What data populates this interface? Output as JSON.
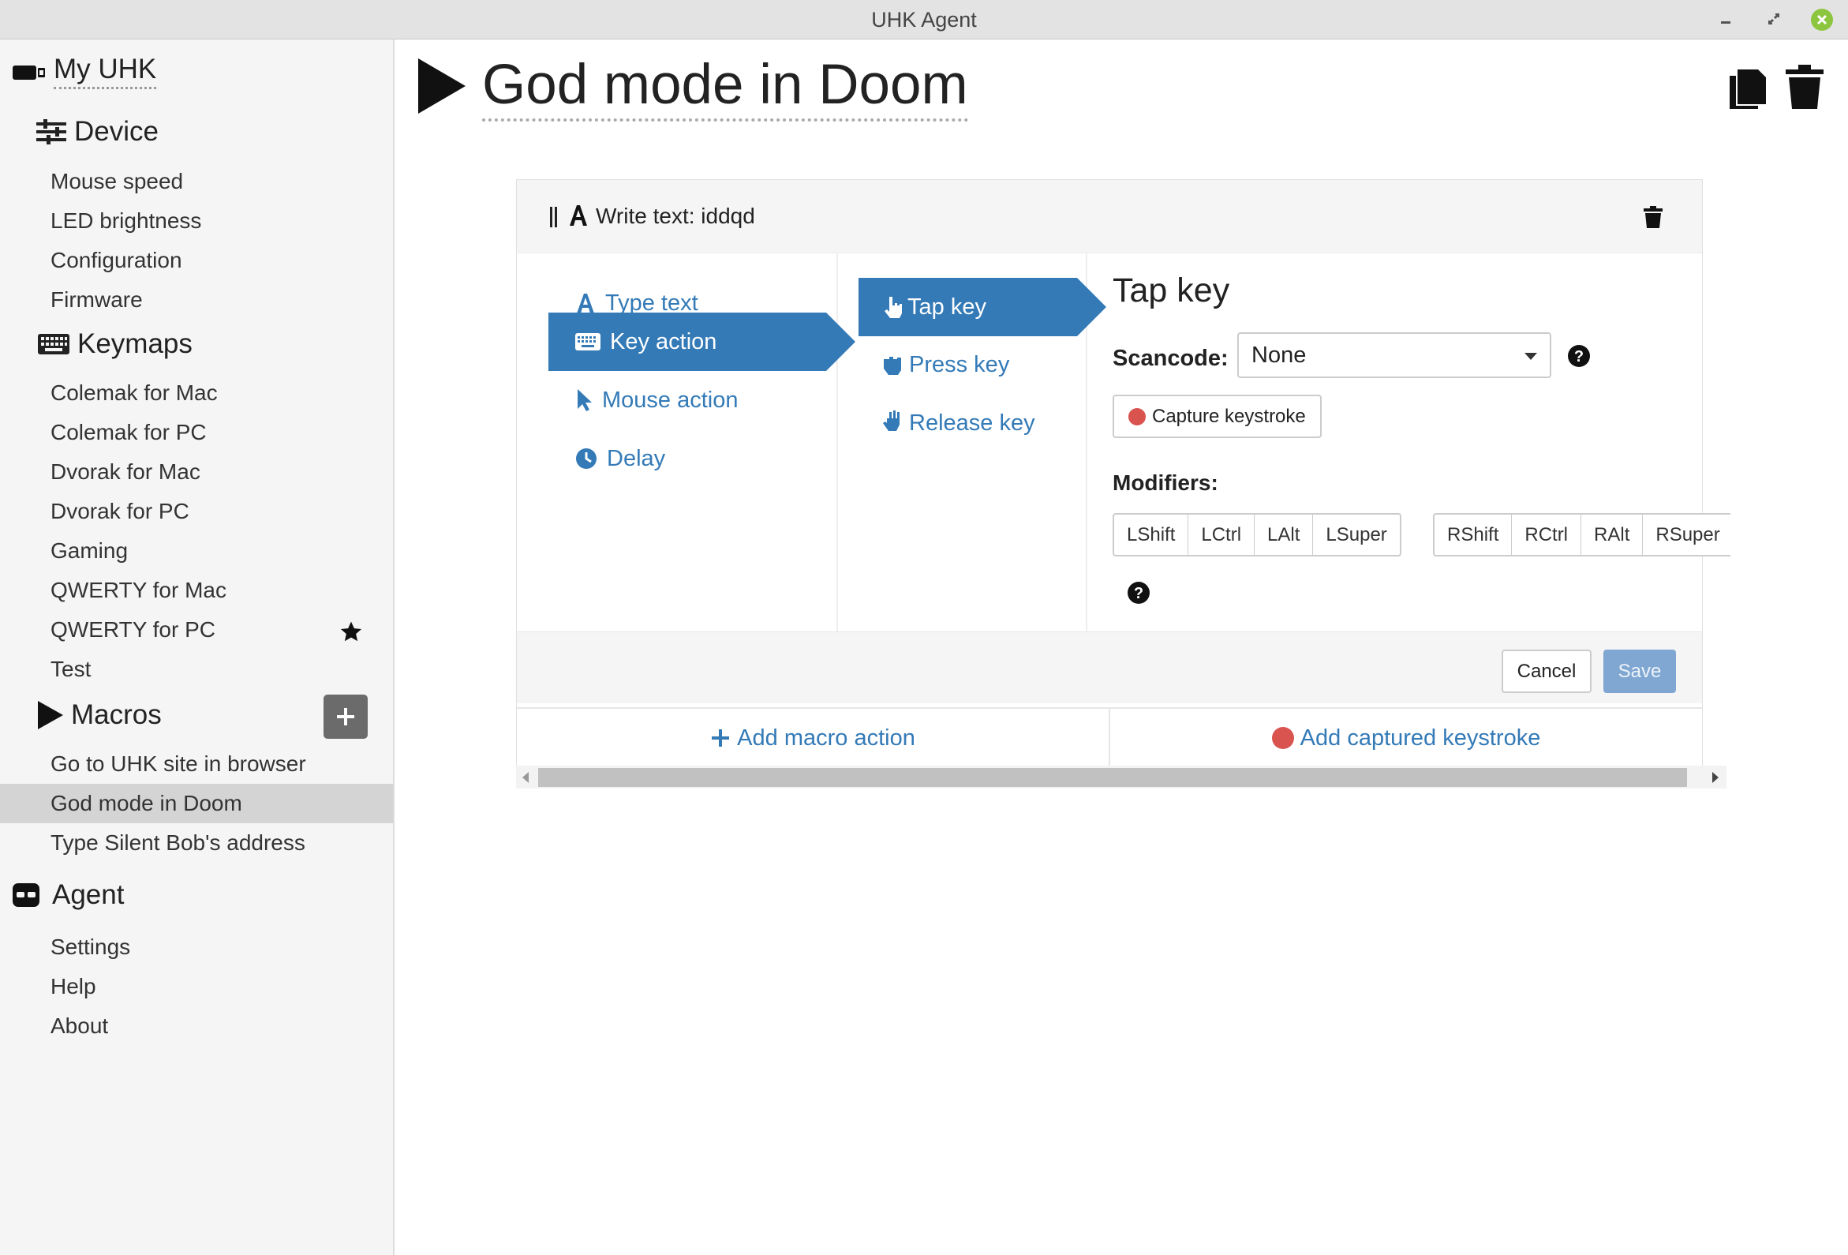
{
  "window": {
    "title": "UHK Agent"
  },
  "sidebar": {
    "my_uhk": "My UHK",
    "device": {
      "label": "Device",
      "items": [
        "Mouse speed",
        "LED brightness",
        "Configuration",
        "Firmware"
      ]
    },
    "keymaps": {
      "label": "Keymaps",
      "items": [
        "Colemak for Mac",
        "Colemak for PC",
        "Dvorak for Mac",
        "Dvorak for PC",
        "Gaming",
        "QWERTY for Mac",
        "QWERTY for PC",
        "Test"
      ],
      "default_keymap": "QWERTY for PC"
    },
    "macros": {
      "label": "Macros",
      "items": [
        "Go to UHK site in browser",
        "God mode in Doom",
        "Type Silent Bob's address"
      ],
      "active": "God mode in Doom"
    },
    "agent": {
      "label": "Agent",
      "items": [
        "Settings",
        "Help",
        "About"
      ]
    }
  },
  "macro": {
    "title": "God mode in Doom"
  },
  "action": {
    "header": "Write text: iddqd",
    "types": [
      "Type text",
      "Key action",
      "Mouse action",
      "Delay"
    ],
    "active_type": "Key action",
    "key_modes": [
      "Tap key",
      "Press key",
      "Release key"
    ],
    "active_key_mode": "Tap key",
    "detail": {
      "title": "Tap key",
      "scancode_label": "Scancode:",
      "scancode_value": "None",
      "capture_label": "Capture keystroke",
      "modifiers_label": "Modifiers:",
      "left_modifiers": [
        "LShift",
        "LCtrl",
        "LAlt",
        "LSuper"
      ],
      "right_modifiers": [
        "RShift",
        "RCtrl",
        "RAlt",
        "RSuper"
      ]
    },
    "cancel": "Cancel",
    "save": "Save"
  },
  "footer": {
    "add_action": "Add macro action",
    "add_captured": "Add captured keystroke"
  },
  "colors": {
    "accent": "#337ab7",
    "record": "#d9534f",
    "close_button": "#8cc63f"
  }
}
